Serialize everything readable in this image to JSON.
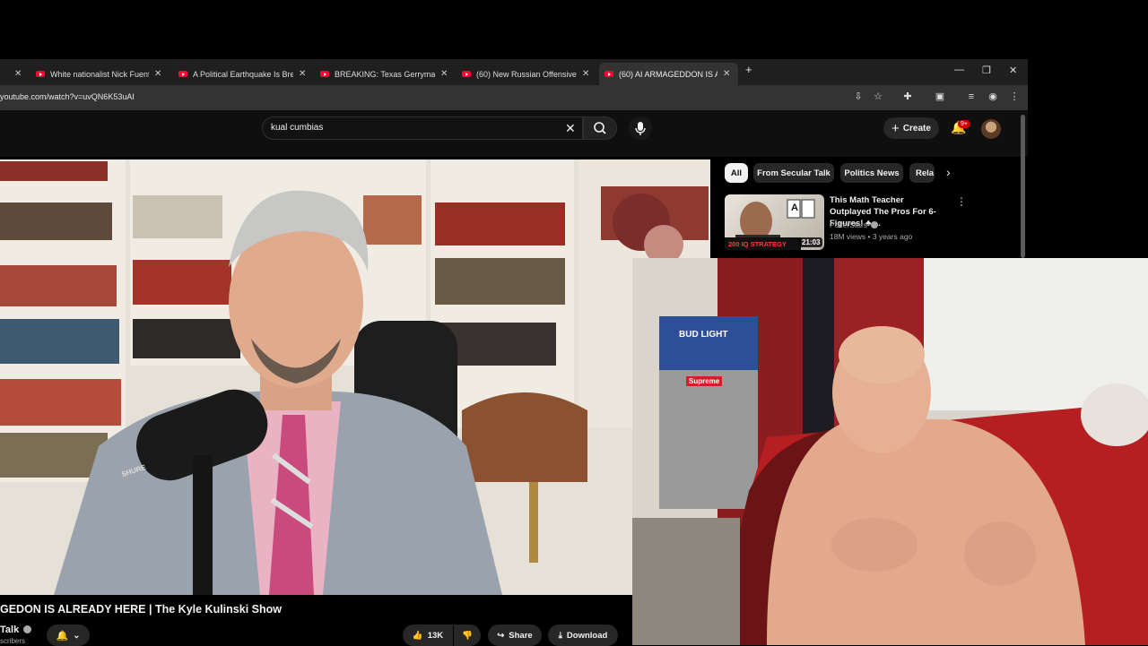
{
  "browser": {
    "tabs": [
      {
        "title": "White nationalist Nick Fuentes"
      },
      {
        "title": "A Political Earthquake Is Brewing"
      },
      {
        "title": "BREAKING: Texas Gerrymander"
      },
      {
        "title": "(60) New Russian Offensive STR"
      },
      {
        "title": "(60) AI ARMAGEDDON IS ALRE",
        "active": true
      }
    ],
    "new_tab": "+",
    "minimize": "—",
    "restore": "❐",
    "close": "✕",
    "url": "youtube.com/watch?v=uvQN6K53uAI"
  },
  "youtube": {
    "search_value": "kual cumbias",
    "create_label": "Create",
    "notification_badge": "9+",
    "chips": [
      "All",
      "From Secular Talk",
      "Politics News",
      "Rela"
    ],
    "recommendation": {
      "title": "This Math Teacher Outplayed The Pros For 6-Figures! ♣ ...",
      "channel": "PokerStars",
      "meta": "18M views • 3 years ago",
      "duration": "21:03",
      "thumb_text": "200 IQ STRATEGY",
      "thumb_card": "A"
    },
    "video_title": "GEDON IS ALREADY HERE | The Kyle Kulinski Show",
    "channel_name": "Talk",
    "subscribers": "scribers",
    "likes": "13K",
    "share_label": "Share",
    "download_label": "Download"
  },
  "scene": {
    "mic_brand": "SHURE",
    "webcam_poster": "BUD LIGHT",
    "webcam_sticker": "Supreme"
  },
  "colors": {
    "youtube_red": "#ff0033",
    "page_bg": "#0f0f0f",
    "chip_bg": "#272727"
  }
}
